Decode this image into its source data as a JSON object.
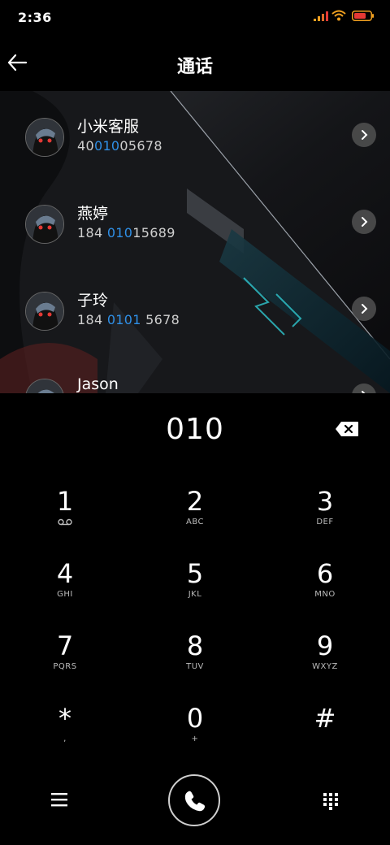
{
  "status_bar": {
    "time": "2:36",
    "battery_color": "#e53935",
    "wifi_color": "#f0a020"
  },
  "header": {
    "title": "通话"
  },
  "contacts": [
    {
      "name": "小米客服",
      "number_pre": "40",
      "number_match": "010",
      "number_post": "05678"
    },
    {
      "name": "燕婷",
      "number_pre": "184 ",
      "number_match": "010",
      "number_post": "15689"
    },
    {
      "name": "子玲",
      "number_pre": "184 ",
      "number_match": "0101",
      "number_post": " 5678"
    },
    {
      "name": "Jason",
      "number_pre": "",
      "number_match": "",
      "number_post": ""
    }
  ],
  "dialer": {
    "dialed_number": "010",
    "keys": [
      {
        "digit": "1",
        "sub": "",
        "sub_icon": "voicemail-icon"
      },
      {
        "digit": "2",
        "sub": "ABC"
      },
      {
        "digit": "3",
        "sub": "DEF"
      },
      {
        "digit": "4",
        "sub": "GHI"
      },
      {
        "digit": "5",
        "sub": "JKL"
      },
      {
        "digit": "6",
        "sub": "MNO"
      },
      {
        "digit": "7",
        "sub": "PQRS"
      },
      {
        "digit": "8",
        "sub": "TUV"
      },
      {
        "digit": "9",
        "sub": "WXYZ"
      },
      {
        "digit": "*",
        "sub": ","
      },
      {
        "digit": "0",
        "sub": "+"
      },
      {
        "digit": "#",
        "sub": ""
      }
    ]
  },
  "colors": {
    "highlight": "#2f8fe6",
    "background": "#000000"
  }
}
